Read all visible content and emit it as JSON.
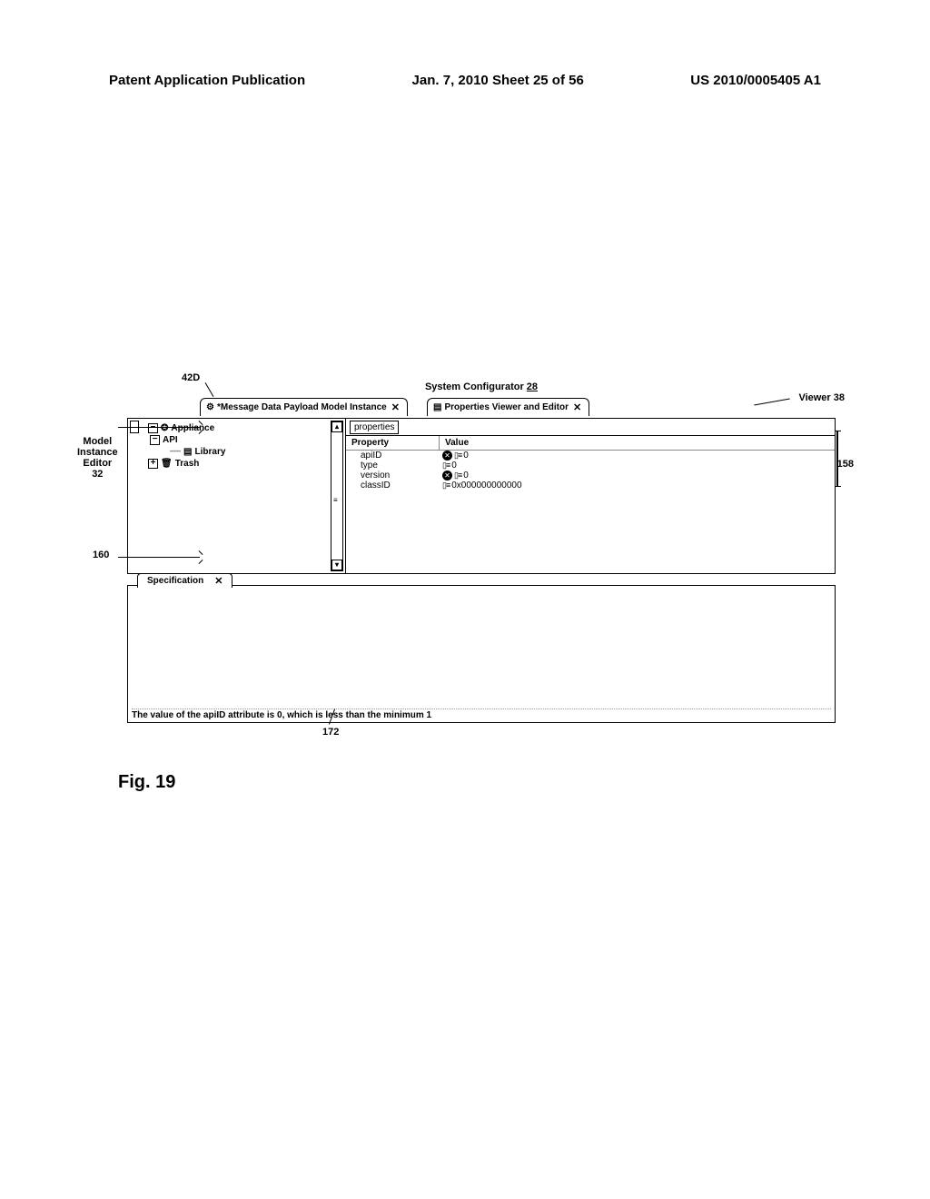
{
  "header": {
    "left": "Patent Application Publication",
    "center": "Jan. 7, 2010   Sheet 25 of 56",
    "right": "US 2010/0005405 A1"
  },
  "title": {
    "text": "System Configurator ",
    "ref": "28"
  },
  "tab_left": {
    "icon": "⚙",
    "label": "*Message Data Payload Model Instance",
    "close": "✕"
  },
  "tab_right": {
    "icon": "▤",
    "label": "Properties Viewer and Editor",
    "close": "✕"
  },
  "tree": {
    "n1": {
      "toggle": "−",
      "icon": "✪",
      "label": "Appliance"
    },
    "n2": {
      "toggle": "−",
      "label": "API"
    },
    "n3": {
      "icon": "▤",
      "label": "Library"
    },
    "n4": {
      "toggle": "+",
      "icon": "🗑",
      "label": "Trash"
    }
  },
  "props": {
    "tab": "properties",
    "h1": "Property",
    "h2": "Value",
    "rows": {
      "r1": {
        "name": "apiID",
        "err": "✕",
        "icon": "▯≡",
        "val": "0"
      },
      "r2": {
        "name": "type",
        "icon": "▯≡",
        "val": "0"
      },
      "r3": {
        "name": "version",
        "err": "✕",
        "icon": "▯≡",
        "val": "0"
      },
      "r4": {
        "name": "classID",
        "icon": "▯≡",
        "val": "0x000000000000"
      }
    }
  },
  "spec": {
    "tab": "Specification",
    "close": "✕",
    "msg": "The value of the apiID attribute is 0,  which is less than the minimum 1"
  },
  "callouts": {
    "c42d": "42D",
    "cModel1": "Model",
    "cModel2": "Instance",
    "cModel3": "Editor",
    "cModel4": "32",
    "c160": "160",
    "cViewer": "Viewer 38",
    "c158": "158",
    "c172": "172"
  },
  "fig": "Fig. 19"
}
